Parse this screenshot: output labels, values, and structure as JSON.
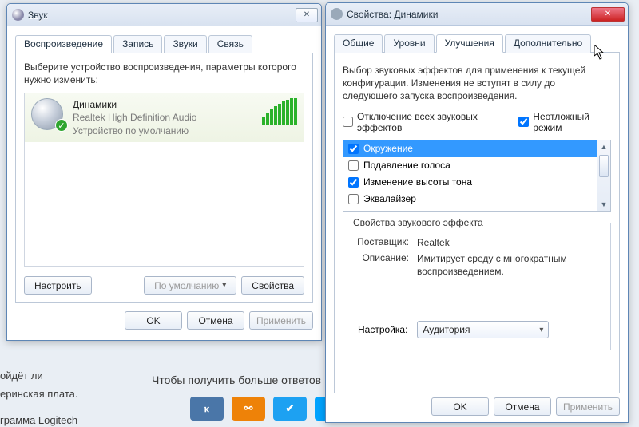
{
  "bg": {
    "t1": "ойдёт ли",
    "t2": "еринская плата.",
    "t3": "грамма Logitech",
    "more": "Чтобы получить больше ответов"
  },
  "social": {
    "vk": "ⲕ",
    "ok": "⚯",
    "tw": "✔",
    "smile": "ツ"
  },
  "common": {
    "ok": "OK",
    "cancel": "Отмена",
    "apply": "Применить"
  },
  "sound": {
    "title": "Звук",
    "tabs": {
      "playback": "Воспроизведение",
      "record": "Запись",
      "sounds": "Звуки",
      "comm": "Связь"
    },
    "hint": "Выберите устройство воспроизведения, параметры которого нужно изменить:",
    "device": {
      "name": "Динамики",
      "driver": "Realtek High Definition Audio",
      "status": "Устройство по умолчанию"
    },
    "configure": "Настроить",
    "default": "По умолчанию",
    "properties": "Свойства"
  },
  "props": {
    "title": "Свойства: Динамики",
    "tabs": {
      "general": "Общие",
      "levels": "Уровни",
      "enh": "Улучшения",
      "adv": "Дополнительно"
    },
    "desc": "Выбор звуковых эффектов для применения к текущей конфигурации. Изменения не вступят в силу до следующего запуска воспроизведения.",
    "disable_all": "Отключение всех звуковых эффектов",
    "urgent": "Неотложный режим",
    "effects": {
      "surround": "Окружение",
      "voice": "Подавление голоса",
      "pitch": "Изменение высоты тона",
      "eq": "Эквалайзер"
    },
    "effects_state": {
      "surround": true,
      "voice": false,
      "pitch": true,
      "eq": false
    },
    "group_title": "Свойства звукового эффекта",
    "vendor_lbl": "Поставщик:",
    "vendor": "Realtek",
    "descr_lbl": "Описание:",
    "description": "Имитирует среду с многократным воспроизведением.",
    "setting_lbl": "Настройка:",
    "setting_value": "Аудитория"
  }
}
